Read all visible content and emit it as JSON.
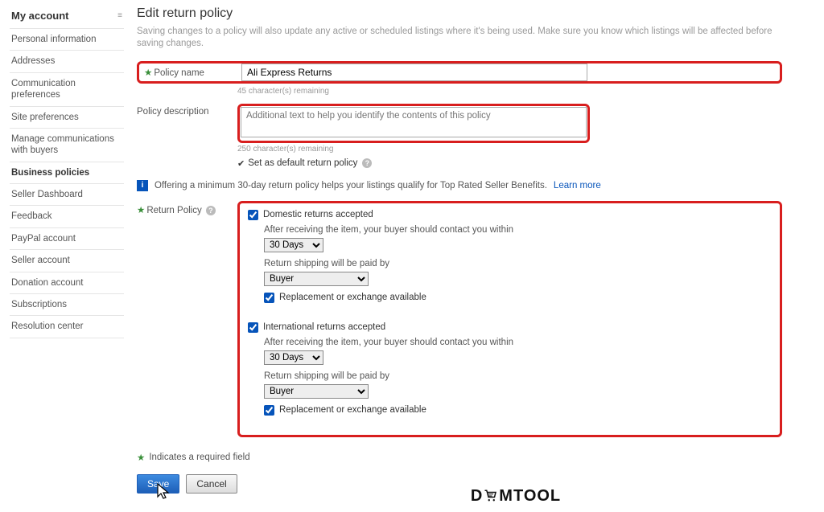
{
  "sidebar": {
    "title": "My account",
    "items": [
      {
        "label": "Personal information"
      },
      {
        "label": "Addresses"
      },
      {
        "label": "Communication preferences"
      },
      {
        "label": "Site preferences"
      },
      {
        "label": "Manage communications with buyers"
      },
      {
        "label": "Business policies"
      },
      {
        "label": "Seller Dashboard"
      },
      {
        "label": "Feedback"
      },
      {
        "label": "PayPal account"
      },
      {
        "label": "Seller account"
      },
      {
        "label": "Donation account"
      },
      {
        "label": "Subscriptions"
      },
      {
        "label": "Resolution center"
      }
    ],
    "active_index": 5
  },
  "page": {
    "title": "Edit return policy",
    "subtitle": "Saving changes to a policy will also update any active or scheduled listings where it's being used. Make sure you know which listings will be affected before saving changes.",
    "required_note": "Indicates a required field"
  },
  "form": {
    "policy_name_label": "Policy name",
    "policy_name_value": "Ali Express Returns",
    "policy_name_helper": "45 character(s) remaining",
    "policy_desc_label": "Policy description",
    "policy_desc_placeholder": "Additional text to help you identify the contents of this policy",
    "policy_desc_helper": "250 character(s) remaining",
    "set_default_label": "Set as default return policy",
    "info_banner": "Offering a minimum 30-day return policy helps your listings qualify for Top Rated Seller Benefits.",
    "learn_more": "Learn more",
    "return_policy_label": "Return Policy",
    "domestic_accepted_label": "Domestic returns accepted",
    "intl_accepted_label": "International returns accepted",
    "contact_within_label": "After receiving the item, your buyer should contact you within",
    "shipping_paid_label": "Return shipping will be paid by",
    "replacement_label": "Replacement or exchange available",
    "days_selected": "30 Days",
    "payer_selected": "Buyer"
  },
  "buttons": {
    "save": "Save",
    "cancel": "Cancel"
  },
  "logo": {
    "part1": "D",
    "part2": "MTOOL"
  }
}
